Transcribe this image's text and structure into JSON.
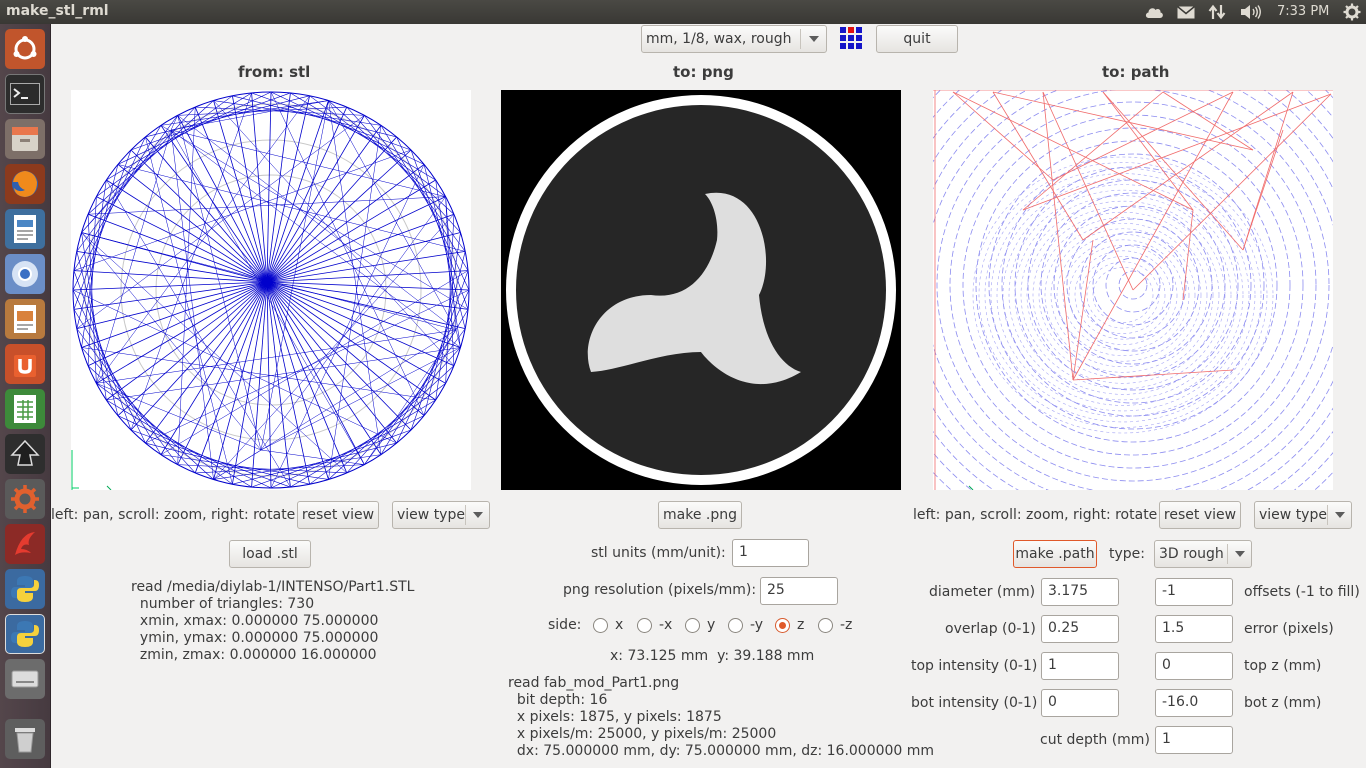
{
  "window": {
    "title": "make_stl_rml",
    "clock": "7:33 PM"
  },
  "toolbar": {
    "profile_selected": "mm, 1/8, wax, rough",
    "quit_label": "quit"
  },
  "stl_panel": {
    "header": "from: stl",
    "hint": "left: pan, scroll: zoom, right: rotate",
    "reset_label": "reset view",
    "view_type": "view type",
    "load_label": "load .stl",
    "info": {
      "line1": "read /media/diylab-1/INTENSO/Part1.STL",
      "line2": "number of triangles: 730",
      "line3": "xmin, xmax: 0.000000 75.000000",
      "line4": "ymin, ymax: 0.000000 75.000000",
      "line5": "zmin, zmax: 0.000000 16.000000"
    }
  },
  "png_panel": {
    "header": "to: png",
    "make_label": "make .png",
    "units_label": "stl units (mm/unit):",
    "units_value": "1",
    "resolution_label": "png resolution (pixels/mm):",
    "resolution_value": "25",
    "side_label": "side:",
    "sides": [
      "x",
      "-x",
      "y",
      "-y",
      "z",
      "-z"
    ],
    "side_selected": "z",
    "coords": "x: 73.125 mm  y: 39.188 mm",
    "info": {
      "line1": "read fab_mod_Part1.png",
      "line2": "bit depth: 16",
      "line3": "x pixels: 1875, y pixels: 1875",
      "line4": "x pixels/m: 25000, y pixels/m: 25000",
      "line5": "dx: 75.000000 mm, dy: 75.000000 mm, dz: 16.000000 mm"
    }
  },
  "path_panel": {
    "header": "to: path",
    "hint": "left: pan, scroll: zoom, right: rotate",
    "reset_label": "reset view",
    "view_type": "view type",
    "make_label": "make .path",
    "type_label": "type:",
    "type_value": "3D rough",
    "params": {
      "diameter_label": "diameter (mm)",
      "diameter_value": "3.175",
      "offsets_value": "-1",
      "offsets_label": "offsets (-1 to fill)",
      "overlap_label": "overlap (0-1)",
      "overlap_value": "0.25",
      "error_value": "1.5",
      "error_label": "error (pixels)",
      "top_intensity_label": "top intensity (0-1)",
      "top_intensity_value": "1",
      "top_z_value": "0",
      "top_z_label": "top z (mm)",
      "bot_intensity_label": "bot intensity (0-1)",
      "bot_intensity_value": "0",
      "bot_z_value": "-16.0",
      "bot_z_label": "bot z (mm)",
      "cut_depth_label": "cut depth (mm)",
      "cut_depth_value": "1"
    }
  },
  "colors": {
    "stl_mesh": "#0000cc",
    "path_blue": "#8c8cf0",
    "path_red": "#f06a6a",
    "accent": "#e0592a"
  }
}
